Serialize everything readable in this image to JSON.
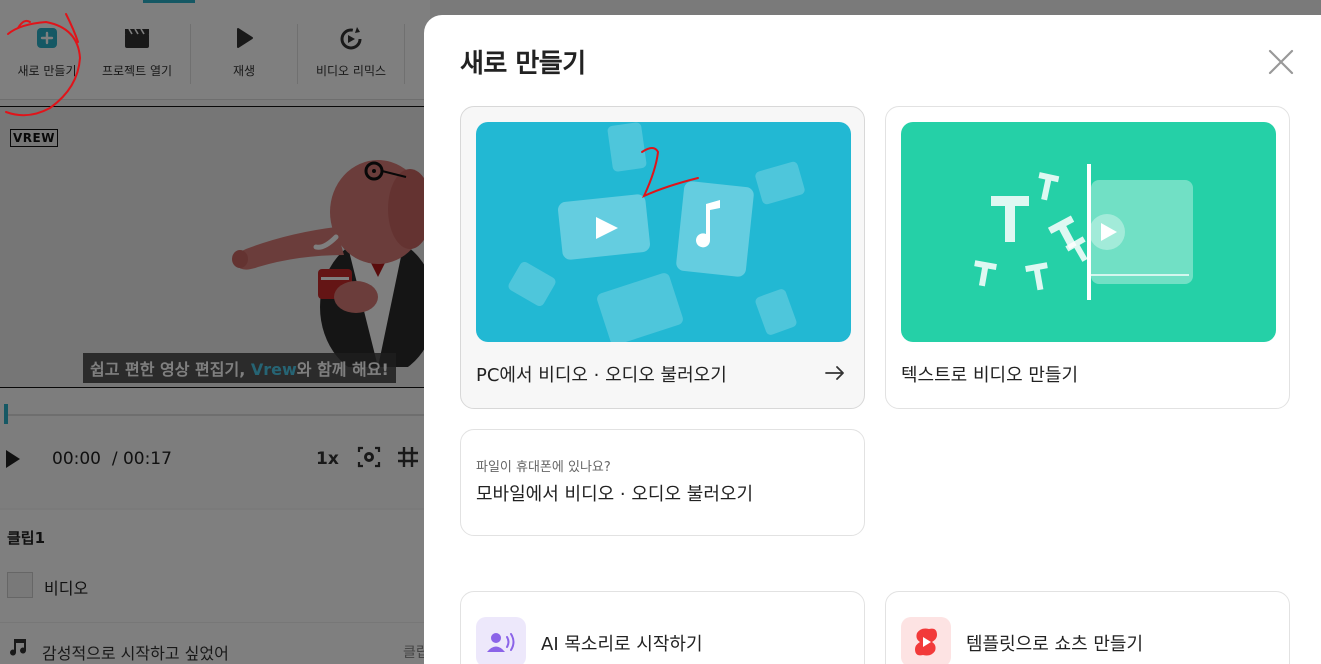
{
  "toolbar": {
    "items": [
      {
        "label": "새로 만들기",
        "icon": "plus-square-icon"
      },
      {
        "label": "프로젝트 열기",
        "icon": "clapperboard-icon"
      },
      {
        "label": "재생",
        "icon": "play-icon"
      },
      {
        "label": "비디오 리믹스",
        "icon": "remix-icon"
      }
    ]
  },
  "preview": {
    "logo": "VREW",
    "subtitle_pre": "쉽고 편한 영상 편집기, ",
    "subtitle_brand": "Vrew",
    "subtitle_post": "와 함께 해요!"
  },
  "player": {
    "current_time": "00:00",
    "total_time": "/ 00:17",
    "speed": "1x"
  },
  "clips": {
    "title": "클립1",
    "video_label": "비디오",
    "text": "감성적으로 시작하고 싶었어",
    "right_label": "클립"
  },
  "modal": {
    "title": "새로 만들기",
    "cards": {
      "pc": {
        "label": "PC에서 비디오 · 오디오 불러오기"
      },
      "text": {
        "label": "텍스트로 비디오 만들기"
      },
      "mobile": {
        "hint": "파일이 휴대폰에 있나요?",
        "label": "모바일에서 비디오 · 오디오 불러오기"
      },
      "ai": {
        "label": "AI 목소리로 시작하기"
      },
      "template": {
        "label": "템플릿으로 쇼츠 만들기"
      }
    }
  },
  "colors": {
    "accent": "#2bb0c9",
    "pc_thumb": "#22b8d3",
    "text_thumb": "#25d0a7",
    "annotation": "#e0141a"
  }
}
